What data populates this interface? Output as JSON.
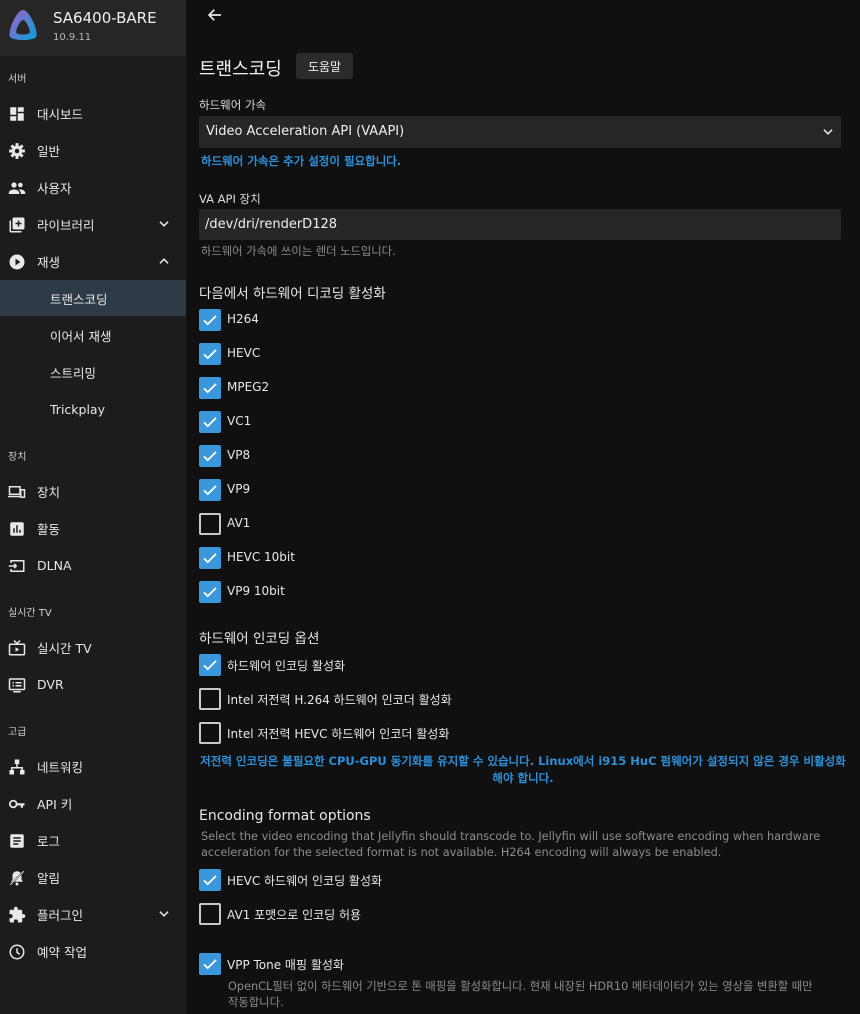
{
  "server": {
    "name": "SA6400-BARE",
    "version": "10.9.11"
  },
  "sidebar": {
    "sections": [
      {
        "header": "서버",
        "items": [
          {
            "label": "대시보드",
            "icon": "dashboard-icon"
          },
          {
            "label": "일반",
            "icon": "gear-icon"
          },
          {
            "label": "사용자",
            "icon": "users-icon"
          },
          {
            "label": "라이브러리",
            "icon": "library-add-icon",
            "chevron": "down"
          },
          {
            "label": "재생",
            "icon": "play-circle-icon",
            "chevron": "up"
          },
          {
            "label": "트랜스코딩",
            "sub": true,
            "active": true
          },
          {
            "label": "이어서 재생",
            "sub": true
          },
          {
            "label": "스트리밍",
            "sub": true
          },
          {
            "label": "Trickplay",
            "sub": true
          }
        ]
      },
      {
        "header": "장치",
        "items": [
          {
            "label": "장치",
            "icon": "devices-icon"
          },
          {
            "label": "활동",
            "icon": "activity-chart-icon"
          },
          {
            "label": "DLNA",
            "icon": "input-icon"
          }
        ]
      },
      {
        "header": "실시간 TV",
        "items": [
          {
            "label": "실시간 TV",
            "icon": "live-tv-icon"
          },
          {
            "label": "DVR",
            "icon": "dvr-icon"
          }
        ]
      },
      {
        "header": "고급",
        "items": [
          {
            "label": "네트워킹",
            "icon": "network-icon"
          },
          {
            "label": "API 키",
            "icon": "key-icon"
          },
          {
            "label": "로그",
            "icon": "log-icon"
          },
          {
            "label": "알림",
            "icon": "notification-icon"
          },
          {
            "label": "플러그인",
            "icon": "extension-icon",
            "chevron": "down"
          },
          {
            "label": "예약 작업",
            "icon": "clock-icon"
          }
        ]
      }
    ]
  },
  "page": {
    "title": "트랜스코딩",
    "help_button": "도움말"
  },
  "hw_accel": {
    "label": "하드웨어 가속",
    "value": "Video Acceleration API (VAAPI)",
    "note": "하드웨어 가속은 추가 설정이 필요합니다."
  },
  "va_device": {
    "label": "VA API 장치",
    "value": "/dev/dri/renderD128",
    "help": "하드웨어 가속에 쓰이는 렌더 노드입니다."
  },
  "decoding": {
    "title": "다음에서 하드웨어 디코딩 활성화",
    "codecs": [
      {
        "label": "H264",
        "checked": true
      },
      {
        "label": "HEVC",
        "checked": true
      },
      {
        "label": "MPEG2",
        "checked": true
      },
      {
        "label": "VC1",
        "checked": true
      },
      {
        "label": "VP8",
        "checked": true
      },
      {
        "label": "VP9",
        "checked": true
      },
      {
        "label": "AV1",
        "checked": false
      },
      {
        "label": "HEVC 10bit",
        "checked": true
      },
      {
        "label": "VP9 10bit",
        "checked": true
      }
    ]
  },
  "encoding": {
    "title": "하드웨어 인코딩 옵션",
    "options": [
      {
        "label": "하드웨어 인코딩 활성화",
        "checked": true
      },
      {
        "label": "Intel 저전력 H.264 하드웨어 인코더 활성화",
        "checked": false
      },
      {
        "label": "Intel 저전력 HEVC 하드웨어 인코더 활성화",
        "checked": false
      }
    ],
    "note_line1": "저전력 인코딩은 불필요한 CPU-GPU 동기화를 유지할 수 있습니다. Linux에서 i915 HuC 펌웨어가 설정되지 않은 경우 비활성화",
    "note_line2": "해야 합니다."
  },
  "encoding_format": {
    "title": "Encoding format options",
    "help_line1": "Select the video encoding that Jellyfin should transcode to. Jellyfin will use software encoding when hardware",
    "help_line2": "acceleration for the selected format is not available. H264 encoding will always be enabled.",
    "options": [
      {
        "label": "HEVC 하드웨어 인코딩 활성화",
        "checked": true
      },
      {
        "label": "AV1 포맷으로 인코딩 허용",
        "checked": false
      }
    ]
  },
  "vpp": {
    "label": "VPP Tone 매핑 활성화",
    "checked": true,
    "help_line1": "OpenCL필터 없이 하드웨어 기반으로 톤 매핑을 활성화합니다. 현재 내장된 HDR10 메타데이터가 있는 영상을 변환할 때만",
    "help_line2": "작동합니다."
  },
  "colors": {
    "accent": "#3a97dc",
    "note_blue": "#2d8fd8",
    "active_nav": "#2e3a45"
  }
}
